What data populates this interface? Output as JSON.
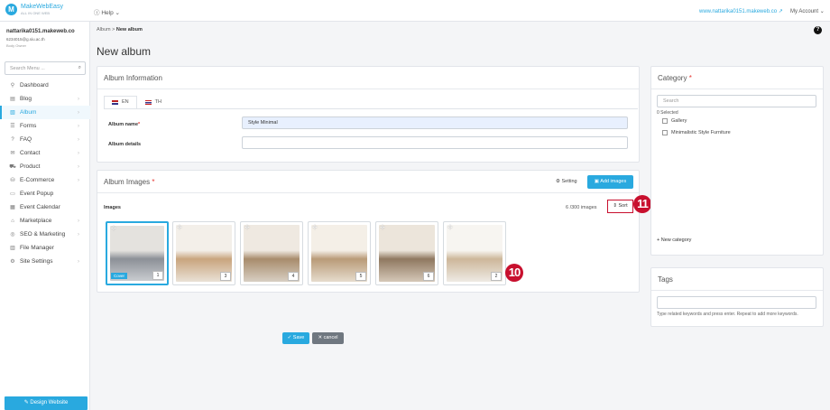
{
  "brand": {
    "name": "MakeWebEasy",
    "tagline": "ALL IN ONE WEB"
  },
  "topbar": {
    "help_label": "Help",
    "user_email": "www.nattarika0151.makeweb.co",
    "account_label": "My Account"
  },
  "sidebar": {
    "site_name": "nattarika0151.makeweb.co",
    "user_email": "6234015@g.siu.ac.th",
    "role": "Body Owner",
    "search_placeholder": "Search Menu ...",
    "items": [
      {
        "label": "Dashboard",
        "icon": "dashboard-icon",
        "chevron": false
      },
      {
        "label": "Blog",
        "icon": "blog-icon",
        "chevron": true
      },
      {
        "label": "Album",
        "icon": "album-icon",
        "chevron": true,
        "active": true
      },
      {
        "label": "Forms",
        "icon": "forms-icon",
        "chevron": true
      },
      {
        "label": "FAQ",
        "icon": "faq-icon",
        "chevron": true
      },
      {
        "label": "Contact",
        "icon": "contact-icon",
        "chevron": true
      },
      {
        "label": "Product",
        "icon": "product-icon",
        "chevron": true
      },
      {
        "label": "E-Commerce",
        "icon": "ecommerce-icon",
        "chevron": true
      },
      {
        "label": "Event Popup",
        "icon": "event-popup-icon",
        "chevron": false
      },
      {
        "label": "Event Calendar",
        "icon": "calendar-icon",
        "chevron": false
      },
      {
        "label": "Marketplace",
        "icon": "marketplace-icon",
        "chevron": true
      },
      {
        "label": "SEO & Marketing",
        "icon": "seo-icon",
        "chevron": true
      },
      {
        "label": "File Manager",
        "icon": "file-manager-icon",
        "chevron": false
      },
      {
        "label": "Site Settings",
        "icon": "settings-icon",
        "chevron": true
      }
    ],
    "design_button": "Design Website"
  },
  "breadcrumb": {
    "parent": "Album",
    "separator": ">",
    "current": "New album"
  },
  "page_title": "New album",
  "album_info": {
    "title": "Album Information",
    "tabs": [
      {
        "label": "EN",
        "active": true
      },
      {
        "label": "TH",
        "active": false
      }
    ],
    "name_label": "Album name",
    "name_value": "Style Minimal",
    "details_label": "Album details",
    "details_value": ""
  },
  "album_images": {
    "title": "Album Images",
    "setting_label": "Setting",
    "add_images_label": "Add images",
    "images_label": "Images",
    "count_label": "6 /300 images",
    "sort_label": "Sort",
    "cover_label": "Cover",
    "images": [
      {
        "number": "1",
        "cover": true,
        "colors": [
          "#c9ccd0",
          "#8c9097",
          "#e4e2de"
        ]
      },
      {
        "number": "3",
        "cover": false,
        "colors": [
          "#e9e1d6",
          "#c9a57e",
          "#f3efe9"
        ]
      },
      {
        "number": "4",
        "cover": false,
        "colors": [
          "#d8cfc3",
          "#a88c6c",
          "#efe9e1"
        ]
      },
      {
        "number": "5",
        "cover": false,
        "colors": [
          "#e6dccd",
          "#b99b78",
          "#f4efe7"
        ]
      },
      {
        "number": "6",
        "cover": false,
        "colors": [
          "#d5c8b8",
          "#8f7860",
          "#ece5db"
        ]
      },
      {
        "number": "2",
        "cover": false,
        "colors": [
          "#eeeae4",
          "#cdb79a",
          "#f7f5f1"
        ]
      }
    ]
  },
  "markers": {
    "sort": "11",
    "last_image": "10"
  },
  "actions": {
    "save_label": "Save",
    "cancel_label": "cancel"
  },
  "category": {
    "title": "Category",
    "search_placeholder": "Search",
    "selected_label": "0 Selected",
    "options": [
      "Gallery",
      "Minimalistic Style Furniture"
    ],
    "new_label": "New category"
  },
  "tags": {
    "title": "Tags",
    "hint": "Type related keywords and press enter. Repeat to add more keywords."
  },
  "colors": {
    "accent": "#29a9df",
    "marker": "#c8102e",
    "required": "#e53935"
  }
}
